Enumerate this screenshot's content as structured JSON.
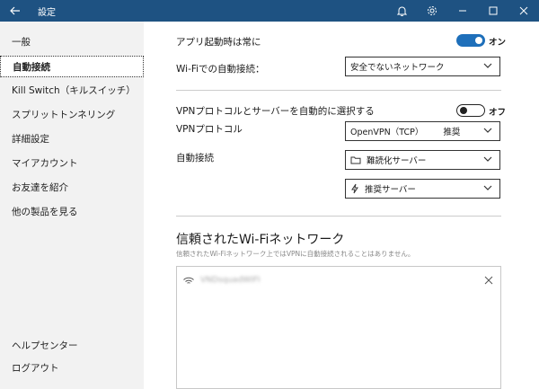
{
  "titlebar": {
    "title": "設定",
    "back_icon": "back-arrow-icon",
    "bell_icon": "bell-icon",
    "settings_icon": "gear-icon",
    "bg_color": "#1e5282"
  },
  "sidebar": {
    "items": [
      {
        "label": "一般"
      },
      {
        "label": "自動接続"
      },
      {
        "label": "Kill Switch（キルスイッチ）"
      },
      {
        "label": "スプリットトンネリング"
      },
      {
        "label": "詳細設定"
      },
      {
        "label": "マイアカウント"
      },
      {
        "label": "お友達を紹介"
      },
      {
        "label": "他の製品を見る"
      }
    ],
    "bottom_items": [
      {
        "label": "ヘルプセンター"
      },
      {
        "label": "ログアウト"
      }
    ],
    "active_item": "自動接続"
  },
  "main": {
    "launch": {
      "label": "アプリ起動時は常に",
      "toggle_on": true,
      "state_text": "オン"
    },
    "wifi_auto": {
      "label": "Wi-Fiでの自動接続：",
      "value": "安全でないネットワーク"
    },
    "vpn_auto_select": {
      "label": "VPNプロトコルとサーバーを自動的に選択する",
      "toggle_on": false,
      "state_text": "オフ"
    },
    "vpn_protocol": {
      "label": "VPNプロトコル",
      "value": "OpenVPN（TCP）",
      "badge": "推奨"
    },
    "auto_connect": {
      "label": "自動接続",
      "server_value": "難読化サーバー",
      "server_icon": "folder-icon",
      "recommended_value": "推奨サーバー",
      "recommended_icon": "lightning-icon"
    },
    "trusted": {
      "title": "信頼されたWi-Fiネットワーク",
      "subtitle": "信頼されたWi-Fiネットワーク上ではVPNに自動接続されることはありません。",
      "networks": [
        {
          "name": "VNDsquadWIFI"
        }
      ]
    }
  },
  "colors": {
    "accent": "#1e6fba",
    "sidebar_bg": "#f2f2f2"
  }
}
